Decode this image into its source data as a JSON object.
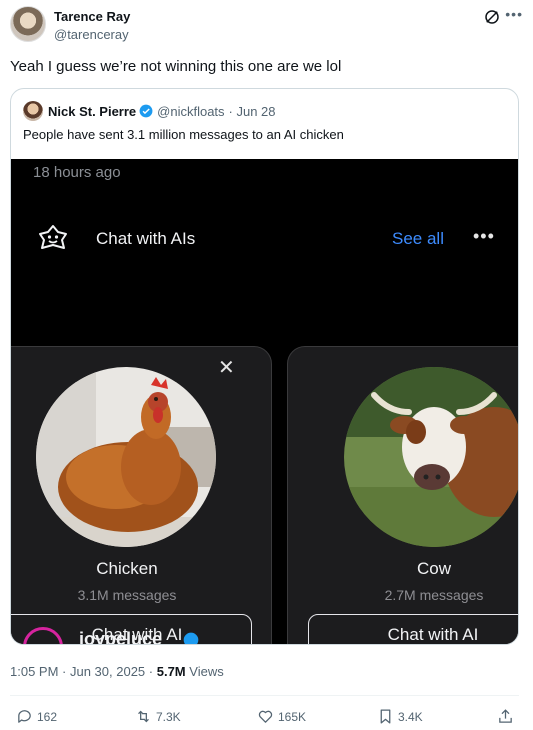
{
  "author": {
    "name": "Tarence Ray",
    "handle": "@tarenceray"
  },
  "tweet": {
    "text": "Yeah I guess we’re not winning this one are we lol"
  },
  "quote": {
    "name": "Nick St. Pierre",
    "handle": "@nickfloats",
    "date": "· Jun 28",
    "text": "People have sent 3.1 million messages to an AI chicken",
    "media": {
      "time_ago": "18 hours ago",
      "section_title": "Chat with AIs",
      "see_all": "See all",
      "cards": [
        {
          "name": "Chicken",
          "messages": "3.1M messages",
          "button": "Chat with AI"
        },
        {
          "name": "Cow",
          "messages": "2.7M messages",
          "button": "Chat with AI"
        }
      ],
      "peek_name": "joypeluce"
    }
  },
  "meta": {
    "time": "1:05 PM",
    "date": "· Jun 30, 2025 ·",
    "views_count": "5.7M",
    "views_label": "Views"
  },
  "actions": {
    "replies": "162",
    "reposts": "7.3K",
    "likes": "165K",
    "bookmarks": "3.4K"
  },
  "colors": {
    "verified": "#1d9bf0",
    "link": "#3d8bfd",
    "muted": "#536471"
  }
}
